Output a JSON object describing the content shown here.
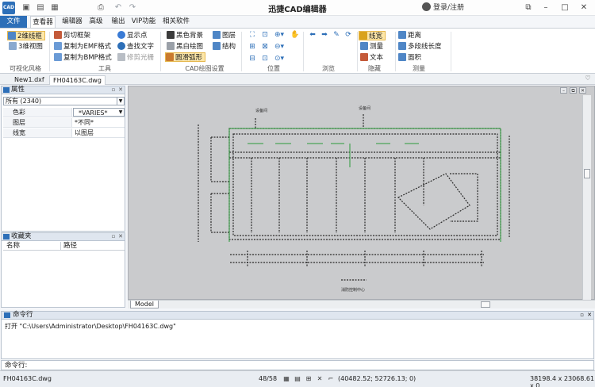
{
  "app": {
    "title": "迅捷CAD编辑器",
    "logo_text": "CAD",
    "login_text": "登录/注册",
    "accent_color": "#2d6fb8"
  },
  "titlebar_icons": [
    "save-icon",
    "folder-icon",
    "save-as-icon",
    "print-icon",
    "undo-icon",
    "redo-icon"
  ],
  "tabs": [
    {
      "label": "文件"
    },
    {
      "label": "查看器"
    },
    {
      "label": "编辑器"
    },
    {
      "label": "高级"
    },
    {
      "label": "输出"
    },
    {
      "label": "VIP功能"
    },
    {
      "label": "相关软件"
    }
  ],
  "ribbon": {
    "groups": [
      {
        "label": "可视化风格"
      },
      {
        "label": "工具"
      },
      {
        "label": "CAD绘图设置"
      },
      {
        "label": "位置"
      },
      {
        "label": "浏览"
      },
      {
        "label": "隐藏"
      },
      {
        "label": "测量"
      }
    ],
    "buttons": {
      "wireframe_2d": "2维线框",
      "wireframe_3d": "3维视图",
      "clip_frame": "剪切框架",
      "copy_emf": "复制为EMF格式",
      "copy_bmp": "复制为BMP格式",
      "show_point": "显示点",
      "find_text": "查找文字",
      "trim_raster": "修剪光栅",
      "black_bg": "黑色背景",
      "bw_draw": "黑白绘图",
      "smooth_arc": "圆滑弧形",
      "layers": "图层",
      "structure": "结构",
      "line_weight": "线宽",
      "measure": "测量",
      "text": "文本",
      "distance": "距离",
      "polyline_length": "多段线长度",
      "area": "面积"
    }
  },
  "doc_tabs": [
    "New1.dxf",
    "FH04163C.dwg"
  ],
  "properties_panel": {
    "title": "属性",
    "selector": "所有 (2340)",
    "rows": [
      {
        "key": "色彩",
        "value": "*VARIES*"
      },
      {
        "key": "图层",
        "value": "*不同*"
      },
      {
        "key": "线宽",
        "value": "以图层"
      }
    ]
  },
  "favorites_panel": {
    "title": "收藏夹",
    "columns": [
      "名称",
      "路径"
    ]
  },
  "drawing": {
    "model_tab": "Model",
    "labels": [
      "设备间",
      "设备间",
      "消防控制中心"
    ]
  },
  "command_panel": {
    "title": "命令行",
    "log": "打开 \"C:\\Users\\Administrator\\Desktop\\FH04163C.dwg\"",
    "prompt_label": "命令行:",
    "input_value": ""
  },
  "status": {
    "filename": "FH04163C.dwg",
    "page": "48/58",
    "coordinates": "(40482.52; 52726.13; 0)",
    "dimensions": "38198.4 x 23068.61 x 0"
  }
}
